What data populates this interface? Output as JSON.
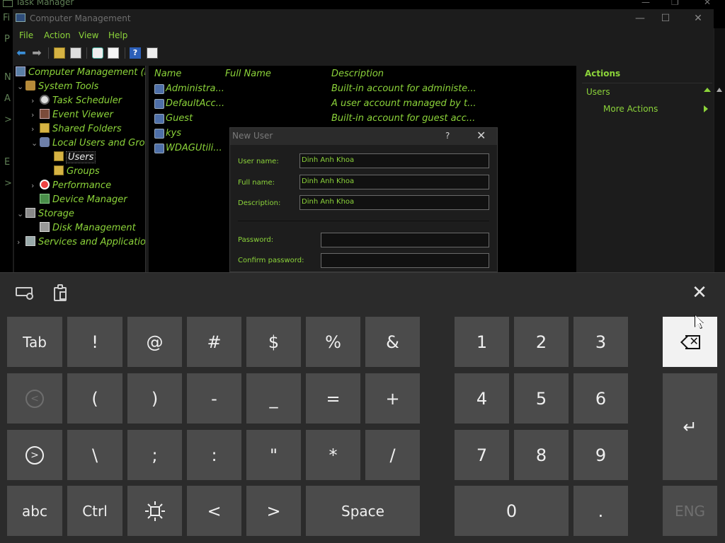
{
  "task_manager": {
    "title": "Task Manager",
    "left_letters": [
      "Fi",
      "P",
      "N",
      "A",
      ">",
      "E",
      ">"
    ]
  },
  "window": {
    "title": "Computer Management",
    "minimize": "—",
    "maximize": "☐",
    "close": "✕"
  },
  "menu": [
    "File",
    "Action",
    "View",
    "Help"
  ],
  "tree": [
    {
      "label": "Computer Management (Lo",
      "arrow": "",
      "icon": "pc",
      "indent": 0
    },
    {
      "label": "System Tools",
      "arrow": "⌄",
      "icon": "tools",
      "indent": 1
    },
    {
      "label": "Task Scheduler",
      "arrow": "›",
      "icon": "clock",
      "indent": 2
    },
    {
      "label": "Event Viewer",
      "arrow": "›",
      "icon": "ev",
      "indent": 2
    },
    {
      "label": "Shared Folders",
      "arrow": "›",
      "icon": "folder",
      "indent": 2
    },
    {
      "label": "Local Users and Grou",
      "arrow": "⌄",
      "icon": "users",
      "indent": 2
    },
    {
      "label": "Users",
      "arrow": "",
      "icon": "folder",
      "indent": 3,
      "selected": true
    },
    {
      "label": "Groups",
      "arrow": "",
      "icon": "folder",
      "indent": 3
    },
    {
      "label": "Performance",
      "arrow": "›",
      "icon": "perf",
      "indent": 2
    },
    {
      "label": "Device Manager",
      "arrow": "",
      "icon": "dev",
      "indent": 2
    },
    {
      "label": "Storage",
      "arrow": "⌄",
      "icon": "storage",
      "indent": 1
    },
    {
      "label": "Disk Management",
      "arrow": "",
      "icon": "disk",
      "indent": 2
    },
    {
      "label": "Services and Applicatior",
      "arrow": "›",
      "icon": "svc",
      "indent": 1
    }
  ],
  "list": {
    "columns": [
      "Name",
      "Full Name",
      "Description"
    ],
    "rows": [
      {
        "name": "Administra...",
        "full_name": "",
        "description": "Built-in account for administe..."
      },
      {
        "name": "DefaultAcc...",
        "full_name": "",
        "description": "A user account managed by t..."
      },
      {
        "name": "Guest",
        "full_name": "",
        "description": "Built-in account for guest acc..."
      },
      {
        "name": "kys",
        "full_name": "",
        "description": ""
      },
      {
        "name": "WDAGUtili...",
        "full_name": "",
        "description": ""
      }
    ]
  },
  "actions": {
    "title": "Actions",
    "section": "Users",
    "item": "More Actions"
  },
  "dialog": {
    "title": "New User",
    "help": "?",
    "close": "✕",
    "user_name_label": "User name:",
    "user_name_value": "Dinh Anh Khoa",
    "full_name_label": "Full name:",
    "full_name_value": "Dinh Anh Khoa",
    "description_label": "Description:",
    "description_value": "Dinh Anh Khoa",
    "password_label": "Password:",
    "password_value": "",
    "confirm_label": "Confirm password:",
    "confirm_value": ""
  },
  "keyboard": {
    "close": "✕",
    "rows": [
      [
        "Tab",
        "!",
        "@",
        "#",
        "$",
        "%",
        "&"
      ],
      [
        "",
        "(",
        ")",
        "-",
        "_",
        "=",
        "+"
      ],
      [
        "",
        "\\",
        ";",
        ":",
        "\"",
        "*",
        "/"
      ],
      [
        "abc",
        "Ctrl",
        "",
        "<",
        ">",
        "Space"
      ]
    ],
    "numpad": [
      [
        "1",
        "2",
        "3"
      ],
      [
        "4",
        "5",
        "6"
      ],
      [
        "7",
        "8",
        "9"
      ],
      [
        "0",
        "."
      ]
    ],
    "enter": "↵",
    "lang": "ENG"
  }
}
